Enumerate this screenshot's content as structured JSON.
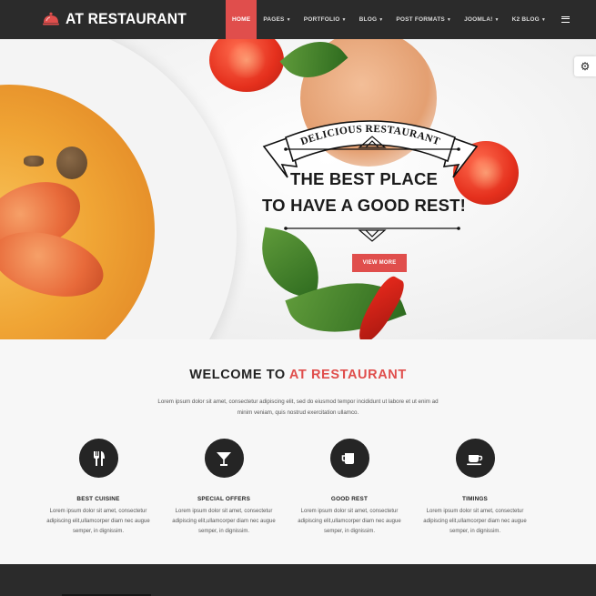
{
  "brand": {
    "name": "AT RESTAURANT",
    "accent_color": "#e04e4c"
  },
  "nav": {
    "items": [
      {
        "label": "HOME",
        "active": true,
        "has_dropdown": false
      },
      {
        "label": "PAGES",
        "active": false,
        "has_dropdown": true
      },
      {
        "label": "PORTFOLIO",
        "active": false,
        "has_dropdown": true
      },
      {
        "label": "BLOG",
        "active": false,
        "has_dropdown": true
      },
      {
        "label": "POST FORMATS",
        "active": false,
        "has_dropdown": true
      },
      {
        "label": "JOOMLA!",
        "active": false,
        "has_dropdown": true
      },
      {
        "label": "K2 BLOG",
        "active": false,
        "has_dropdown": true
      }
    ],
    "menu_icon": "hamburger-icon"
  },
  "hero": {
    "ribbon_text": "DELICIOUS RESTAURANT",
    "headline_line1": "THE BEST PLACE",
    "headline_line2": "TO HAVE A GOOD REST!",
    "cta_label": "VIEW MORE"
  },
  "settings": {
    "icon": "gear-icon"
  },
  "welcome": {
    "title_prefix": "WELCOME TO",
    "title_accent": "AT RESTAURANT",
    "description": "Lorem ipsum dolor sit amet, consectetur adipiscing elit, sed do eiusmod tempor incididunt ut labore et ut enim ad minim veniam, quis nostrud exercitation ullamco."
  },
  "features": [
    {
      "icon": "cutlery-icon",
      "title": "BEST CUISINE",
      "text": "Lorem ipsum dolor sit amet, consectetur adipiscing elit,ullamcorper diam nec augue semper, in dignissim."
    },
    {
      "icon": "cocktail-icon",
      "title": "SPECIAL OFFERS",
      "text": "Lorem ipsum dolor sit amet, consectetur adipiscing elit,ullamcorper diam nec augue semper, in dignissim."
    },
    {
      "icon": "cup-icon",
      "title": "GOOD REST",
      "text": "Lorem ipsum dolor sit amet, consectetur adipiscing elit,ullamcorper diam nec augue semper, in dignissim."
    },
    {
      "icon": "coffee-icon",
      "title": "TIMINGS",
      "text": "Lorem ipsum dolor sit amet, consectetur adipiscing elit,ullamcorper diam nec augue semper, in dignissim."
    }
  ]
}
